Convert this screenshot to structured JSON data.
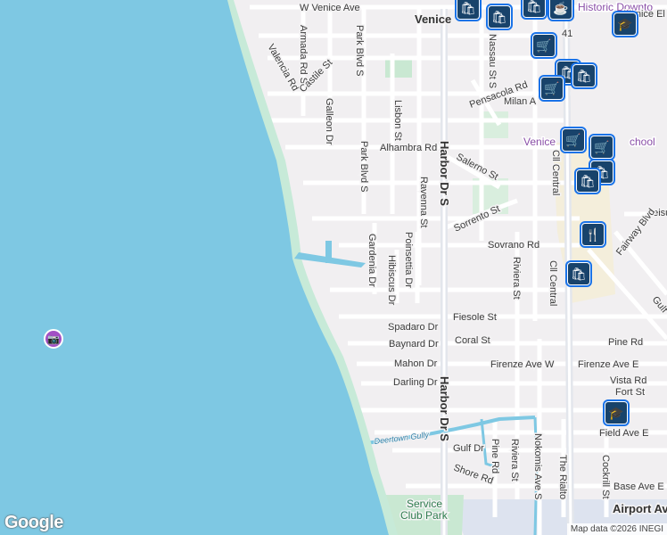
{
  "map": {
    "colors": {
      "water": "#7ec8e3",
      "beach": "#c7ead8",
      "land": "#f1eff1",
      "road": "#ffffff",
      "major_road": "#e6e9ee",
      "park": "#c9e8d2",
      "airport": "#dde3ef",
      "pin_border": "#1a73e8",
      "pin_fill": "#18436b",
      "poi_photo": "#a24fc4"
    },
    "place_labels": [
      {
        "id": "venice",
        "text": "Venice"
      },
      {
        "id": "historic-downtown",
        "text": "Historic Downto"
      },
      {
        "id": "venice-el",
        "text": "Venice El"
      },
      {
        "id": "venice-school",
        "text": "Venice"
      },
      {
        "id": "school-suffix",
        "text": "chool"
      },
      {
        "id": "service-club-park",
        "text": "Service\nClub Park"
      },
      {
        "id": "airport",
        "text": "Airport Ave"
      }
    ],
    "streets": [
      {
        "id": "w-venice-ave",
        "text": "W Venice Ave"
      },
      {
        "id": "armada-rd",
        "text": "Armada Rd S"
      },
      {
        "id": "valencia-rd",
        "text": "Valencia Rd"
      },
      {
        "id": "castile-st",
        "text": "Castile St"
      },
      {
        "id": "park-blvd-s-n",
        "text": "Park Blvd S"
      },
      {
        "id": "galleon-dr",
        "text": "Galleon Dr"
      },
      {
        "id": "lisbon-st",
        "text": "Lisbon St"
      },
      {
        "id": "pensacola-rd",
        "text": "Pensacola Rd"
      },
      {
        "id": "milan-ave",
        "text": "Milan A"
      },
      {
        "id": "nassau-st",
        "text": "Nassau St S"
      },
      {
        "id": "alhambra-rd",
        "text": "Alhambra Rd"
      },
      {
        "id": "park-blvd-s-s",
        "text": "Park Blvd S"
      },
      {
        "id": "harbor-dr-n",
        "text": "Harbor Dr S"
      },
      {
        "id": "salerno-st",
        "text": "Salerno St"
      },
      {
        "id": "ravenna-st",
        "text": "Ravenna St"
      },
      {
        "id": "cll-central-n",
        "text": "Cll Central"
      },
      {
        "id": "sorrento-st",
        "text": "Sorrento St"
      },
      {
        "id": "leisure",
        "text": "Leisu"
      },
      {
        "id": "gardenia-dr",
        "text": "Gardenia Dr"
      },
      {
        "id": "poinsettia-dr",
        "text": "Poinsettia Dr"
      },
      {
        "id": "hibiscus-dr",
        "text": "Hibiscus Dr"
      },
      {
        "id": "sovrano-rd",
        "text": "Sovrano Rd"
      },
      {
        "id": "riviera-st-n",
        "text": "Riviera St"
      },
      {
        "id": "cll-central-s",
        "text": "Cll Central"
      },
      {
        "id": "fairway-blvd",
        "text": "Fairway Blvd"
      },
      {
        "id": "gulf-dr-n",
        "text": "Gulf"
      },
      {
        "id": "fiesole-st",
        "text": "Fiesole St"
      },
      {
        "id": "spadaro-dr",
        "text": "Spadaro Dr"
      },
      {
        "id": "baynard-dr",
        "text": "Baynard Dr"
      },
      {
        "id": "coral-st",
        "text": "Coral St"
      },
      {
        "id": "pine-rd",
        "text": "Pine Rd"
      },
      {
        "id": "mahon-dr",
        "text": "Mahon Dr"
      },
      {
        "id": "firenze-ave-w",
        "text": "Firenze Ave W"
      },
      {
        "id": "firenze-ave-e",
        "text": "Firenze Ave E"
      },
      {
        "id": "vista-rd",
        "text": "Vista Rd"
      },
      {
        "id": "darling-dr",
        "text": "Darling Dr"
      },
      {
        "id": "harbor-dr-s",
        "text": "Harbor Dr S"
      },
      {
        "id": "fort-st",
        "text": "Fort St"
      },
      {
        "id": "field-ave",
        "text": "Field Ave E"
      },
      {
        "id": "deertown-gully",
        "text": "Deertown Gully"
      },
      {
        "id": "gulf-dr-s",
        "text": "Gulf Dr"
      },
      {
        "id": "pine-rd-s",
        "text": "Pine Rd"
      },
      {
        "id": "riviera-st-s",
        "text": "Riviera St"
      },
      {
        "id": "nokomis-ave",
        "text": "Nokomis Ave S"
      },
      {
        "id": "the-rialto",
        "text": "The Rialto"
      },
      {
        "id": "cockrill-st",
        "text": "Cockrill St"
      },
      {
        "id": "shore-rd",
        "text": "Shore Rd"
      },
      {
        "id": "base-ave",
        "text": "Base Ave E"
      },
      {
        "id": "route-41",
        "text": "41"
      }
    ],
    "pins": [
      {
        "id": "pin-1",
        "icon": "shopping-bag-icon",
        "glyph": "🛍"
      },
      {
        "id": "pin-2",
        "icon": "shopping-bag-icon",
        "glyph": "🛍"
      },
      {
        "id": "pin-3",
        "icon": "shopping-bag-icon",
        "glyph": "🛍"
      },
      {
        "id": "pin-4",
        "icon": "coffee-icon",
        "glyph": "☕"
      },
      {
        "id": "pin-5",
        "icon": "shopping-cart-icon",
        "glyph": "🛒"
      },
      {
        "id": "pin-6",
        "icon": "school-icon",
        "glyph": "🎓"
      },
      {
        "id": "pin-7",
        "icon": "shopping-bag-icon",
        "glyph": "🛍"
      },
      {
        "id": "pin-8",
        "icon": "shopping-cart-icon",
        "glyph": "🛒"
      },
      {
        "id": "pin-9",
        "icon": "shopping-bag-icon",
        "glyph": "🛍"
      },
      {
        "id": "pin-10",
        "icon": "shopping-cart-icon",
        "glyph": "🛒"
      },
      {
        "id": "pin-11",
        "icon": "shopping-cart-icon",
        "glyph": "🛒"
      },
      {
        "id": "pin-12",
        "icon": "shopping-bag-icon",
        "glyph": "🛍"
      },
      {
        "id": "pin-13",
        "icon": "shopping-bag-icon",
        "glyph": "🛍"
      },
      {
        "id": "pin-14",
        "icon": "restaurant-icon",
        "glyph": "🍴"
      },
      {
        "id": "pin-15",
        "icon": "shopping-bag-icon",
        "glyph": "🛍"
      },
      {
        "id": "pin-16",
        "icon": "school-icon",
        "glyph": "🎓"
      }
    ],
    "photo_poi": {
      "icon": "camera-icon",
      "glyph": "📷"
    }
  },
  "footer": {
    "logo": "Google",
    "attribution": "Map data ©2026 INEGI"
  }
}
